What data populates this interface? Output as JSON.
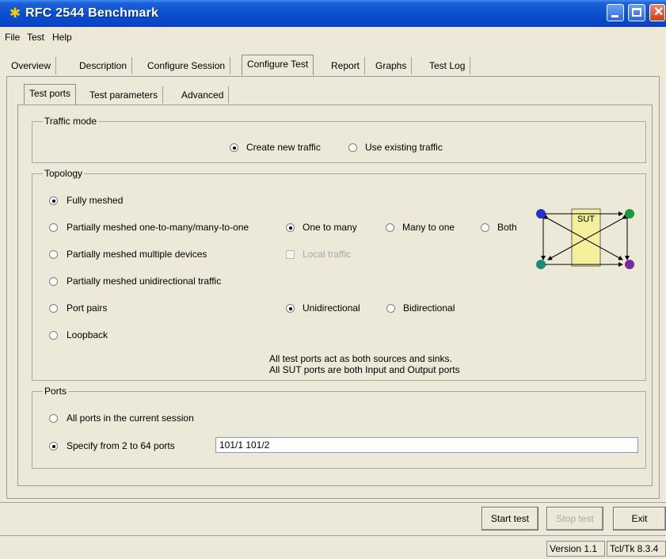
{
  "window": {
    "title": "RFC 2544 Benchmark"
  },
  "menu": [
    "File",
    "Test",
    "Help"
  ],
  "main_tabs": [
    "Overview",
    "Description",
    "Configure Session",
    "Configure Test",
    "Report",
    "Graphs",
    "Test Log"
  ],
  "sub_tabs": [
    "Test ports",
    "Test parameters",
    "Advanced"
  ],
  "traffic_mode": {
    "legend": "Traffic mode",
    "create_new": "Create new traffic",
    "use_existing": "Use existing traffic"
  },
  "topology": {
    "legend": "Topology",
    "fully_meshed": "Fully meshed",
    "partial_one_many": "Partially meshed one-to-many/many-to-one",
    "partial_multiple": "Partially meshed multiple devices",
    "partial_unidirectional": "Partially meshed unidirectional traffic",
    "port_pairs": "Port pairs",
    "loopback": "Loopback",
    "one_to_many": "One to many",
    "many_to_one": "Many to one",
    "both": "Both",
    "local_traffic": "Local traffic",
    "unidirectional": "Unidirectional",
    "bidirectional": "Bidirectional",
    "note_line1": "All test ports act as both sources and sinks.",
    "note_line2": "All SUT ports are both Input and Output ports",
    "diagram_label": "SUT"
  },
  "ports": {
    "legend": "Ports",
    "all_ports": "All ports in the current session",
    "specify": "Specify from 2 to 64 ports",
    "value": "101/1 101/2"
  },
  "buttons": {
    "start": "Start test",
    "stop": "Stop test",
    "exit": "Exit"
  },
  "status": {
    "version": "Version 1.1",
    "tcltk": "Tcl/Tk 8.3.4"
  },
  "colors": {
    "titlebar": "#0a4fd0",
    "sut_box": "#f3ef9a",
    "port_blue": "#2233cc",
    "port_green": "#1a9a3a",
    "port_teal": "#1a8a7a",
    "port_purple": "#7a2aa0"
  }
}
